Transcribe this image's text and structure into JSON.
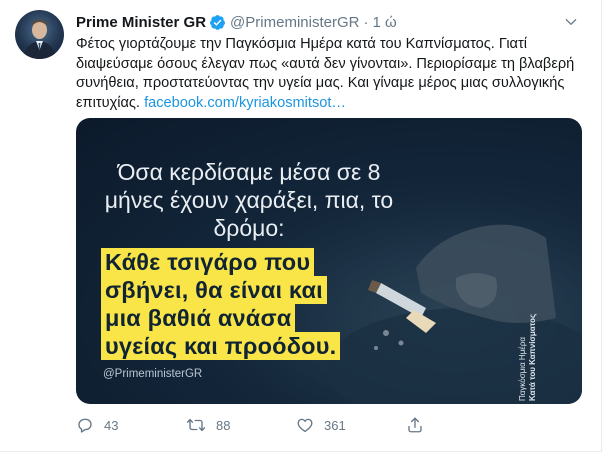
{
  "tweet": {
    "author_name": "Prime Minister GR",
    "handle": "@PrimeministerGR",
    "separator": "·",
    "time": "1 ώ",
    "text": "Φέτος γιορτάζουμε την Παγκόσμια Ημέρα κατά του Καπνίσματος. Γιατί διαψεύσαμε όσους έλεγαν πως «αυτά δεν γίνονται». Περιορίσαμε τη βλαβερή συνήθεια, προστατεύοντας την υγεία μας. Και γίναμε μέρος μιας συλλογικής επιτυχίας.",
    "link": "facebook.com/kyriakosmitsot…"
  },
  "media": {
    "intro": "Όσα κερδίσαμε μέσα σε 8 μήνες έχουν χαράξει, πια, το δρόμο:",
    "highlight_lines": [
      "Κάθε τσιγάρο που",
      "σβήνει, θα είναι και",
      "μια βαθιά ανάσα",
      "υγείας και προόδου."
    ],
    "signature": "@PrimeministerGR",
    "side_text_1": "Παγκόσμια Ημέρα",
    "side_text_2": "Κατά του Καπνίσματος"
  },
  "actions": {
    "reply_count": "43",
    "retweet_count": "88",
    "like_count": "361"
  },
  "colors": {
    "link": "#1b95e0",
    "highlight": "#f9e547",
    "verified": "#1da1f2",
    "muted": "#657786"
  }
}
